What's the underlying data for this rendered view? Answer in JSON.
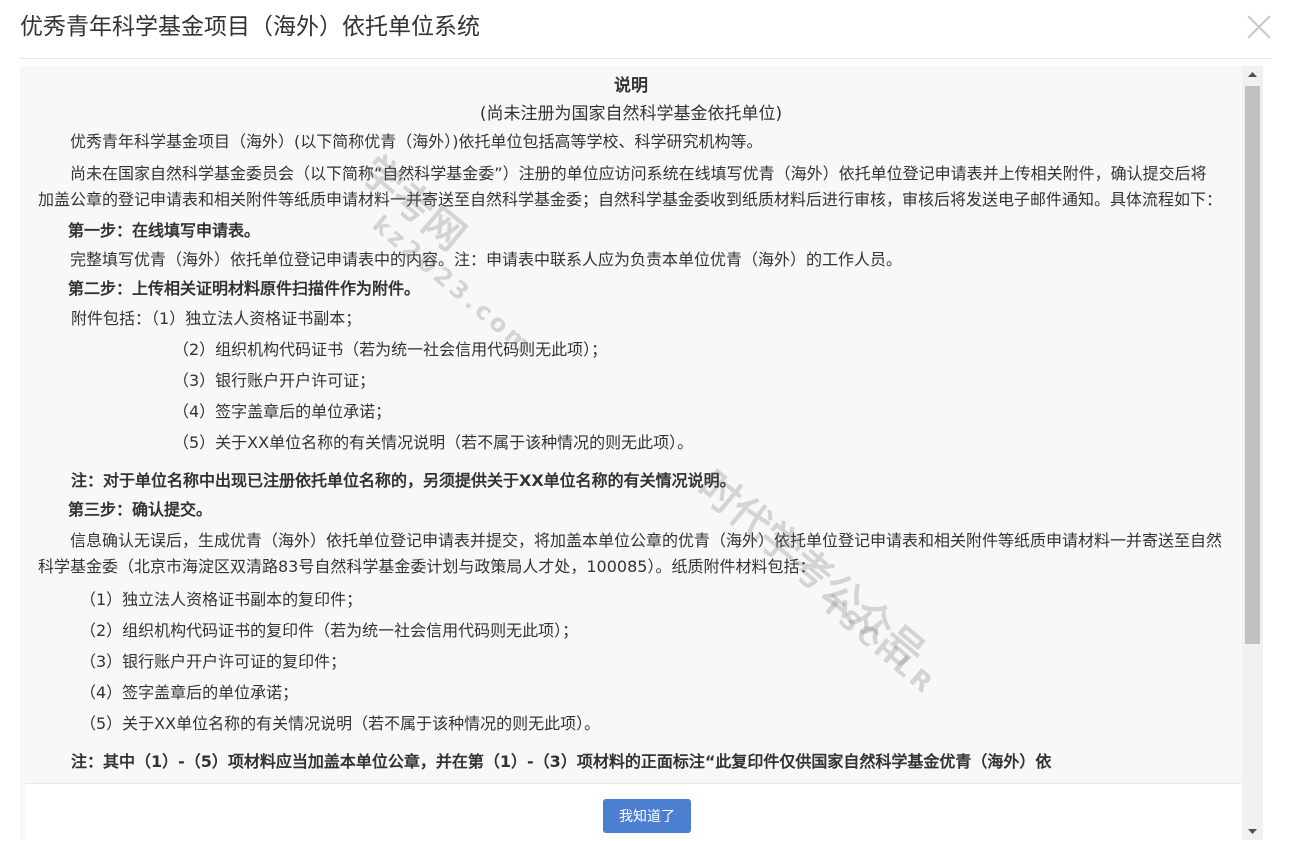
{
  "dialog": {
    "title": "优秀青年科学基金项目（海外）依托单位系统"
  },
  "content": {
    "heading": "说明",
    "subheading": "(尚未注册为国家自然科学基金依托单位)",
    "intro": "优秀青年科学基金项目（海外）(以下简称优青（海外）)依托单位包括高等学校、科学研究机构等。",
    "paragraph1": "尚未在国家自然科学基金委员会（以下简称“自然科学基金委”）注册的单位应访问系统在线填写优青（海外）依托单位登记申请表并上传相关附件，确认提交后将加盖公章的登记申请表和相关附件等纸质申请材料一并寄送至自然科学基金委；自然科学基金委收到纸质材料后进行审核，审核后将发送电子邮件通知。具体流程如下：",
    "step1_title": "第一步：在线填写申请表。",
    "step1_text": "完整填写优青（海外）依托单位登记申请表中的内容。注：申请表中联系人应为负责本单位优青（海外）的工作人员。",
    "step2_title": "第二步：上传相关证明材料原件扫描件作为附件。",
    "attachments_label": "附件包括：",
    "attachments": [
      "（1）独立法人资格证书副本；",
      "（2）组织机构代码证书（若为统一社会信用代码则无此项）；",
      "（3）银行账户开户许可证；",
      "（4）签字盖章后的单位承诺；",
      "（5）关于XX单位名称的有关情况说明（若不属于该种情况的则无此项）。"
    ],
    "note1": "注：对于单位名称中出现已注册依托单位名称的，另须提供关于XX单位名称的有关情况说明。",
    "step3_title": "第三步：确认提交。",
    "step3_text": "信息确认无误后，生成优青（海外）依托单位登记申请表并提交，将加盖本单位公章的优青（海外）依托单位登记申请表和相关附件等纸质申请材料一并寄送至自然科学基金委（北京市海淀区双清路83号自然科学基金委计划与政策局人才处，100085）。纸质附件材料包括：",
    "paper_items": [
      "（1）独立法人资格证书副本的复印件；",
      "（2）组织机构代码证书的复印件（若为统一社会信用代码则无此项）；",
      "（3）银行账户开户许可证的复印件；",
      "（4）签字盖章后的单位承诺；",
      "（5）关于XX单位名称的有关情况说明（若不属于该种情况的则无此项）。"
    ],
    "note2": "注：其中（1）-（5）项材料应当加盖本单位公章，并在第（1）-（3）项材料的正面标注“此复印件仅供国家自然科学基金优青（海外）依"
  },
  "watermarks": {
    "text1": "学考网",
    "text2": "时代学考公众号",
    "url": "kz2023.com",
    "en": "TSCHLR"
  },
  "footer": {
    "ok_label": "我知道了"
  },
  "colors": {
    "primary_button": "#4c7fd0",
    "content_bg": "#f8f8f8"
  }
}
